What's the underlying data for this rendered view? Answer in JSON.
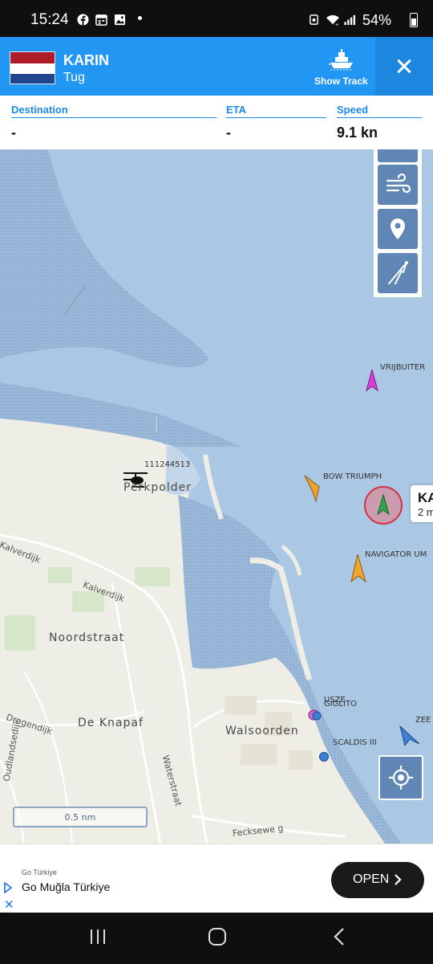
{
  "status_bar": {
    "time": "15:24",
    "battery": "54%"
  },
  "vessel": {
    "name": "KARIN",
    "type": "Tug",
    "flag": "netherlands-flag",
    "flag_colors": [
      "#ae1c28",
      "#ffffff",
      "#21468b"
    ],
    "show_track_label": "Show Track"
  },
  "info": {
    "destination_label": "Destination",
    "destination_value": "-",
    "eta_label": "ETA",
    "eta_value": "-",
    "speed_label": "Speed",
    "speed_value": "9.1 kn"
  },
  "map": {
    "water_color": "#aac7e4",
    "land_color": "#efeee6",
    "ships": [
      {
        "name": "VRIJBUITER",
        "color": "#d63fd6"
      },
      {
        "name": "BOW TRIUMPH",
        "color": "#f0a32e"
      },
      {
        "name": "NAVIGATOR UM",
        "color": "#f0a32e"
      },
      {
        "name": "SCALDIS III",
        "color": "#3f7fd6"
      },
      {
        "name": "ZEE",
        "color": "#3f7fd6"
      }
    ],
    "overlapped_labels": [
      "USZE",
      "GIGLITO"
    ],
    "helicopter_label": "111244513",
    "selected": {
      "name": "KA",
      "sub": "2 m"
    },
    "places": [
      "Perkpolder",
      "Noordstraat",
      "De Knapaf",
      "Walsoorden"
    ],
    "roads": [
      "Kalverdijk",
      "Kalverdijk",
      "Drogendijk",
      "Waterstraat",
      "Oudlandsedijk",
      "Fecksewe g"
    ],
    "scale": "0.5 nm"
  },
  "ad": {
    "advertiser": "Go Türkiye",
    "title": "Go Muğla Türkiye",
    "cta": "OPEN"
  }
}
